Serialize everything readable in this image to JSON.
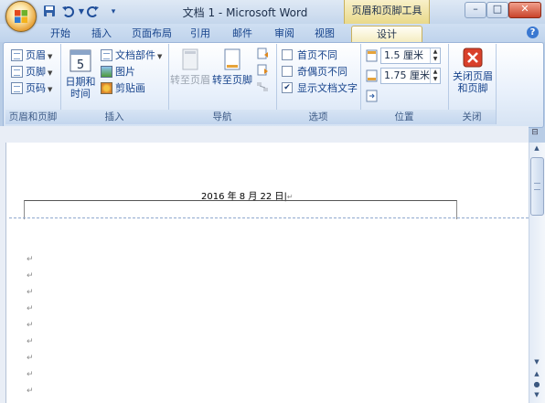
{
  "window": {
    "title": "文档 1 - Microsoft Word",
    "context_tab_title": "页眉和页脚工具",
    "minimize_label": "–",
    "maximize_label": "□",
    "close_label": "✕"
  },
  "qat": {
    "save_icon": "save-icon",
    "undo_icon": "undo-icon",
    "redo_icon": "redo-icon",
    "customize_icon": "customize-qat-icon"
  },
  "tabs": [
    "开始",
    "插入",
    "页面布局",
    "引用",
    "邮件",
    "审阅",
    "视图",
    "设计"
  ],
  "active_tab": "设计",
  "ribbon": {
    "header_footer_group": {
      "label": "页眉和页脚",
      "header": "页眉",
      "footer": "页脚",
      "page_number": "页码"
    },
    "insert_group": {
      "label": "插入",
      "date_time_line1": "日期和",
      "date_time_line2": "时间",
      "calendar_day": "5",
      "quick_parts": "文档部件",
      "picture": "图片",
      "clip_art": "剪贴画"
    },
    "navigation_group": {
      "label": "导航",
      "goto_header": "转至页眉",
      "goto_footer": "转至页脚"
    },
    "options_group": {
      "label": "选项",
      "first_page": "首页不同",
      "odd_even": "奇偶页不同",
      "show_text": "显示文档文字",
      "first_page_checked": false,
      "odd_even_checked": false,
      "show_text_checked": true
    },
    "position_group": {
      "label": "位置",
      "header_from_top": "1.5 厘米",
      "footer_from_bottom": "1.75 厘米"
    },
    "close_group": {
      "label": "关闭",
      "close_line1": "关闭页眉",
      "close_line2": "和页脚"
    }
  },
  "document": {
    "header_text": "2016 年 8 月 22 日",
    "paragraph_mark": "↵"
  },
  "colors": {
    "accent": "#15428b",
    "context_tab": "#f4ecbd",
    "close_red": "#d9402a"
  }
}
